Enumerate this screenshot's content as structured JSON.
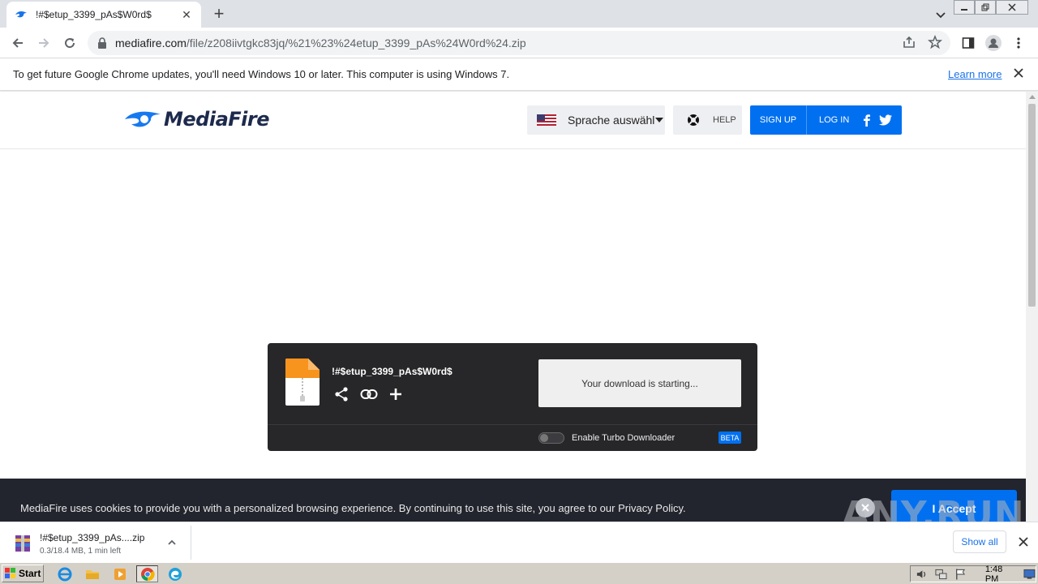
{
  "browser": {
    "tab_title": "!#$etup_3399_pAs$W0rd$",
    "url_domain": "mediafire.com",
    "url_path": "/file/z208iivtgkc83jq/%21%23%24etup_3399_pAs%24W0rd%24.zip"
  },
  "infobar": {
    "message": "To get future Google Chrome updates, you'll need Windows 10 or later. This computer is using Windows 7.",
    "link": "Learn more"
  },
  "header": {
    "logo_text": "MediaFire",
    "language_label": "Sprache auswählen",
    "help_label": "HELP",
    "signup_label": "SIGN UP",
    "login_label": "LOG IN"
  },
  "download": {
    "filename": "!#$etup_3399_pAs$W0rd$",
    "status": "Your download is starting...",
    "turbo_label": "Enable Turbo Downloader",
    "beta_badge": "BETA"
  },
  "cookie": {
    "message": "MediaFire uses cookies to provide you with a personalized browsing experience. By continuing to use this site, you agree to our Privacy Policy.",
    "accept_label": "I Accept"
  },
  "watermark": "ANY.RUN",
  "shelf": {
    "filename": "!#$etup_3399_pAs....zip",
    "progress": "0.3/18.4 MB, 1 min left",
    "show_all": "Show all"
  },
  "taskbar": {
    "start_label": "Start",
    "clock": "1:48 PM"
  },
  "colors": {
    "mediafire_blue": "#0070f0",
    "download_box_bg": "#27272a",
    "cookie_bar_bg": "#22252e"
  }
}
